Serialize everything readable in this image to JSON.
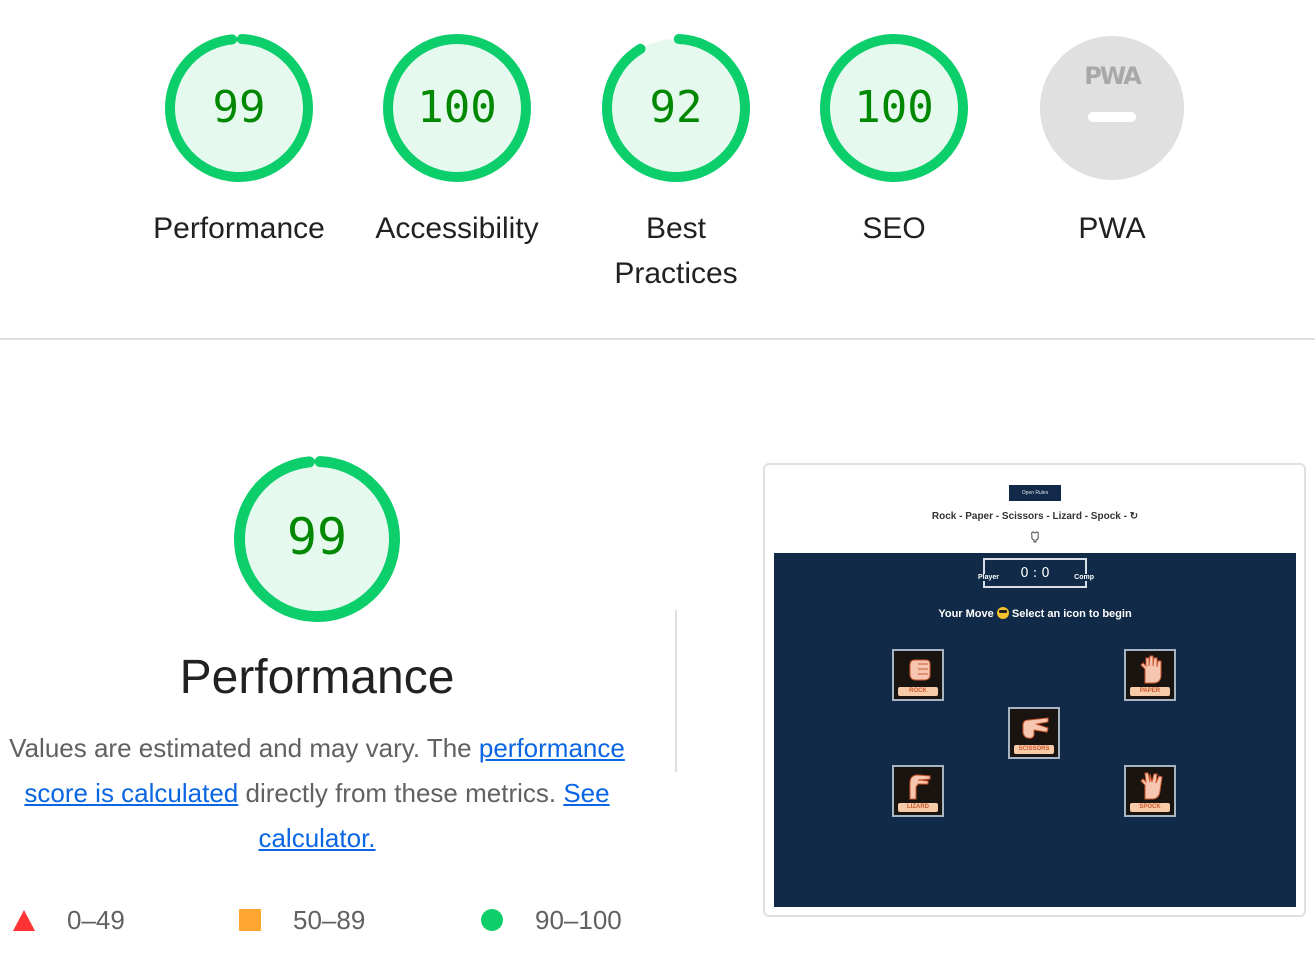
{
  "categories": [
    {
      "id": "performance",
      "label": "Performance",
      "score": "99",
      "fraction": 0.99
    },
    {
      "id": "accessibility",
      "label": "Accessibility",
      "score": "100",
      "fraction": 1.0
    },
    {
      "id": "best-practices",
      "label": "Best Practices",
      "score": "92",
      "fraction": 0.92
    },
    {
      "id": "seo",
      "label": "SEO",
      "score": "100",
      "fraction": 1.0
    },
    {
      "id": "pwa",
      "label": "PWA",
      "badge": "PWA",
      "score": null
    }
  ],
  "performance_section": {
    "score": "99",
    "fraction": 0.99,
    "title": "Performance",
    "desc_part1": "Values are estimated and may vary. The ",
    "link1": "performance score is calculated",
    "desc_part2": " directly from these metrics. ",
    "link2": "See calculator."
  },
  "legend": [
    {
      "shape": "triangle",
      "range": "0–49",
      "color": "#ff3333"
    },
    {
      "shape": "square",
      "range": "50–89",
      "color": "#ffa630"
    },
    {
      "shape": "circle",
      "range": "90–100",
      "color": "#0cce6b"
    }
  ],
  "colors": {
    "pass_ring": "#0cce6b",
    "pass_fill": "#e6f9ef",
    "pass_text": "#008800",
    "pwa_fill": "#e0e0e0",
    "link": "#0b66e4",
    "board": "#112a47"
  },
  "screenshot": {
    "rules_button": "Open Rules",
    "game_title": "Rock - Paper - Scissors - Lizard - Spock -",
    "refresh_icon": "↻",
    "github_icon": "⌂",
    "player_label": "Player",
    "comp_label": "Comp",
    "score": "0 : 0",
    "status_prefix": "Your Move",
    "status_suffix": "Select an icon to begin",
    "moves": [
      "ROCK",
      "PAPER",
      "SCISSORS",
      "LIZARD",
      "SPOCK"
    ]
  }
}
